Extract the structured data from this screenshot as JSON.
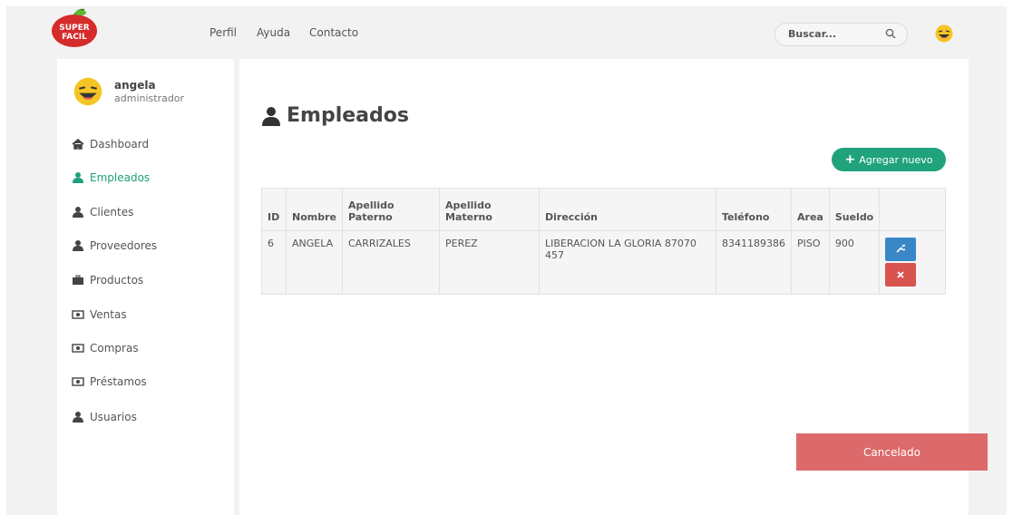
{
  "header": {
    "logo_text": "SUPER FACIL",
    "nav": [
      {
        "label": "Perfil"
      },
      {
        "label": "Ayuda"
      },
      {
        "label": "Contacto"
      }
    ],
    "search_placeholder": "Buscar...",
    "search_icon": "search-icon",
    "avatar_icon": "laughing-emoji-icon"
  },
  "sidebar": {
    "user": {
      "name": "angela",
      "role": "administrador"
    },
    "items": [
      {
        "label": "Dashboard",
        "icon": "home-icon",
        "active": false
      },
      {
        "label": "Empleados",
        "icon": "user-icon",
        "active": true
      },
      {
        "label": "Clientes",
        "icon": "user-icon",
        "active": false
      },
      {
        "label": "Proveedores",
        "icon": "user-icon",
        "active": false
      },
      {
        "label": "Productos",
        "icon": "briefcase-icon",
        "active": false
      },
      {
        "label": "Ventas",
        "icon": "money-icon",
        "active": false
      },
      {
        "label": "Compras",
        "icon": "money-icon",
        "active": false
      },
      {
        "label": "Préstamos",
        "icon": "money-icon",
        "active": false
      },
      {
        "label": "Usuarios",
        "icon": "user-icon",
        "active": false
      }
    ]
  },
  "main": {
    "title": "Empleados",
    "add_button": "Agregar nuevo",
    "table": {
      "headers": [
        "ID",
        "Nombre",
        "Apellido Paterno",
        "Apellido Materno",
        "Dirección",
        "Teléfono",
        "Area",
        "Sueldo",
        ""
      ],
      "rows": [
        {
          "id": "6",
          "nombre": "ANGELA",
          "paterno": "CARRIZALES",
          "materno": "PEREZ",
          "direccion": "LIBERACION LA GLORIA 87070 457",
          "telefono": "8341189386",
          "area": "PISO",
          "sueldo": "900"
        }
      ]
    }
  },
  "toast": {
    "message": "Cancelado"
  },
  "colors": {
    "accent": "#20a37c",
    "edit": "#3a87c8",
    "delete": "#d9534f",
    "toast": "#dc6a6a"
  }
}
